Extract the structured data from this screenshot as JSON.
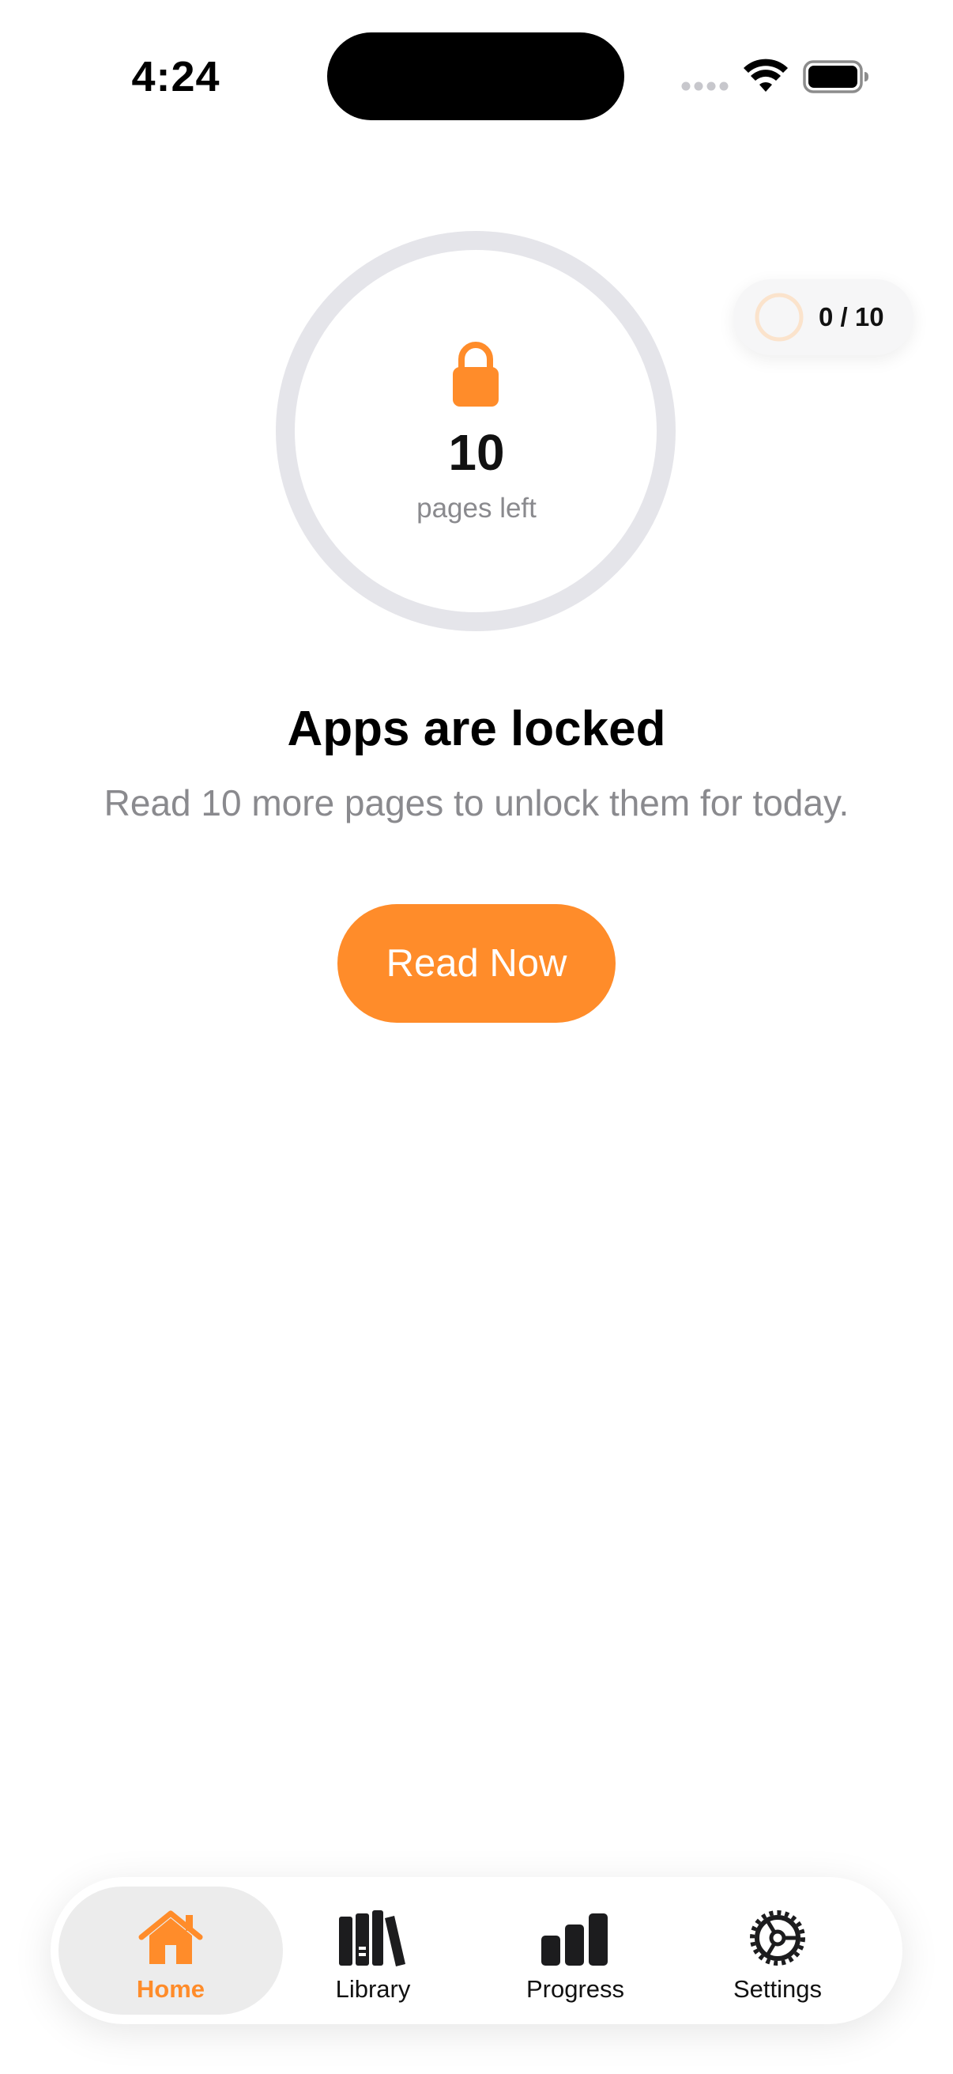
{
  "status_bar": {
    "time": "4:24",
    "icons": [
      "signal-icon",
      "wifi-icon",
      "battery-icon"
    ]
  },
  "progress_pill": {
    "text": "0 / 10",
    "icon": "progress-ring-icon",
    "progress_fraction": 0
  },
  "lock_ring": {
    "icon": "lock-icon",
    "count": "10",
    "caption": "pages left",
    "progress_fraction": 0
  },
  "message": {
    "title": "Apps are locked",
    "subtitle": "Read 10 more pages to unlock them for today."
  },
  "read_button": {
    "label": "Read Now"
  },
  "tab_bar": {
    "tabs": [
      {
        "label": "Home",
        "icon": "home-icon",
        "active": true
      },
      {
        "label": "Library",
        "icon": "books-icon",
        "active": false
      },
      {
        "label": "Progress",
        "icon": "bar-chart-icon",
        "active": false
      },
      {
        "label": "Settings",
        "icon": "gear-icon",
        "active": false
      }
    ]
  },
  "colors": {
    "accent": "#ff8c2a",
    "ring_track": "#e5e5ea",
    "secondary_text": "#8a8a8e",
    "pill_ring": "#fbe3cc"
  }
}
